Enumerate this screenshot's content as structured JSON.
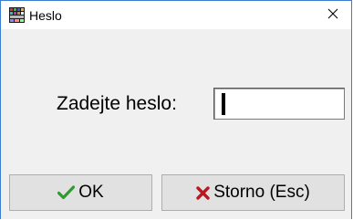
{
  "window": {
    "title": "Heslo",
    "accent_color": "#3c7fd0"
  },
  "titlebar": {
    "app_icon": "keyboard-app-icon",
    "close_icon": "close-icon"
  },
  "dialog": {
    "prompt_label": "Zadejte heslo:",
    "password_value": ""
  },
  "buttons": {
    "ok_label": "OK",
    "ok_icon": "checkmark-icon",
    "ok_icon_color": "#2e9c2e",
    "cancel_label": "Storno (Esc)",
    "cancel_icon": "x-icon",
    "cancel_icon_color": "#c0141e"
  }
}
